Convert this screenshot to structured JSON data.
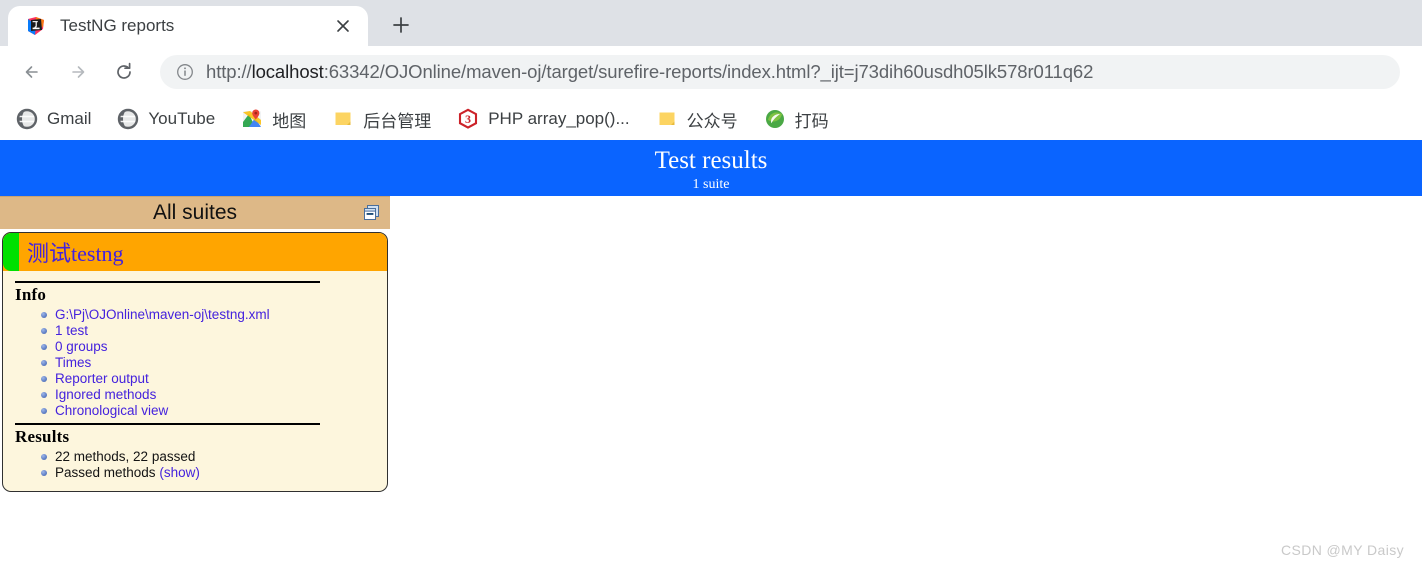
{
  "browser": {
    "tab": {
      "title": "TestNG reports",
      "favicon": "intellij-idea-icon",
      "close_icon": "close-icon"
    },
    "new_tab_icon": "plus-icon",
    "nav": {
      "back_icon": "back-arrow-icon",
      "forward_icon": "forward-arrow-icon",
      "reload_icon": "reload-icon"
    },
    "omnibox": {
      "site_info_icon": "info-circle-icon",
      "url_scheme": "http://",
      "url_host": "localhost",
      "url_rest": ":63342/OJOnline/maven-oj/target/surefire-reports/index.html?_ijt=j73dih60usdh05lk578r011q62",
      "url_full": "http://localhost:63342/OJOnline/maven-oj/target/surefire-reports/index.html?_ijt=j73dih60usdh05lk578r011q62"
    },
    "bookmarks": [
      {
        "label": "Gmail",
        "icon": "globe-icon"
      },
      {
        "label": "YouTube",
        "icon": "globe-icon"
      },
      {
        "label": "地图",
        "icon": "google-maps-icon"
      },
      {
        "label": "后台管理",
        "icon": "folder-icon"
      },
      {
        "label": "PHP array_pop()...",
        "icon": "w3schools-icon"
      },
      {
        "label": "公众号",
        "icon": "folder-icon"
      },
      {
        "label": "打码",
        "icon": "leaf-icon"
      }
    ]
  },
  "report": {
    "banner": {
      "title": "Test results",
      "subtitle": "1 suite",
      "background": "#0a64ff"
    },
    "all_suites": {
      "header_label": "All suites",
      "collapse_icon": "collapse-panel-icon",
      "header_background": "#ddb887"
    },
    "suite": {
      "name": "测试testng",
      "status_color": "#00e000",
      "header_background": "#ffa500",
      "name_color": "#4422dd",
      "info": {
        "title": "Info",
        "items": [
          "G:\\Pj\\OJOnline\\maven-oj\\testng.xml",
          "1 test",
          "0 groups",
          "Times",
          "Reporter output",
          "Ignored methods",
          "Chronological view"
        ]
      },
      "results": {
        "title": "Results",
        "methods_summary": "22 methods, 22 passed",
        "passed_methods_label": "Passed methods",
        "passed_methods_link": "(show)"
      }
    }
  },
  "watermark": "CSDN @MY Daisy"
}
